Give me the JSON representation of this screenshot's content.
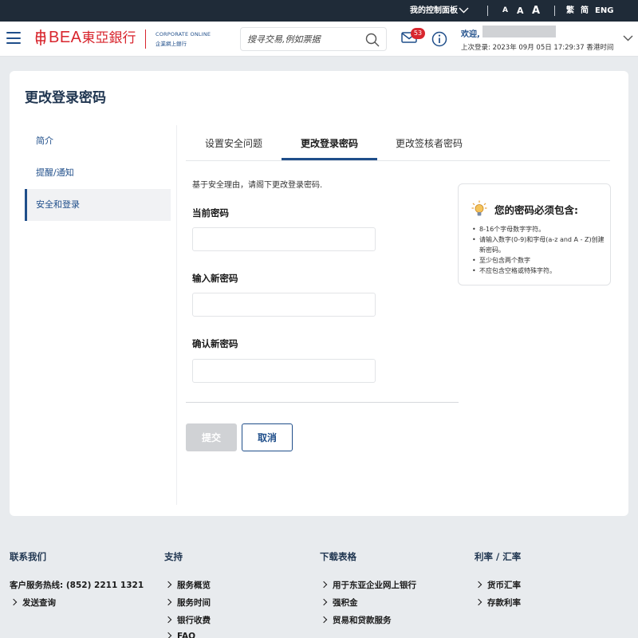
{
  "topbar": {
    "dashboard_label": "我的控制面板",
    "font_small": "A",
    "font_medium": "A",
    "font_large": "A",
    "lang_trad": "繁",
    "lang_simp": "简",
    "lang_en": "ENG"
  },
  "header": {
    "logo_text": "BEA",
    "logo_cn": "東亞銀行",
    "corporate_en": "CORPORATE ONLINE",
    "corporate_cn": "企業網上銀行",
    "search_placeholder": "搜寻交易,例如票据",
    "mail_badge": "53",
    "welcome": "欢迎,",
    "last_login": "上次登录: 2023年 09月 05日 17:29:37 香港时间"
  },
  "page": {
    "title": "更改登录密码"
  },
  "sidenav": {
    "items": [
      {
        "label": "简介"
      },
      {
        "label": "提醒/通知"
      },
      {
        "label": "安全和登录"
      }
    ]
  },
  "tabs": [
    {
      "label": "设置安全问题"
    },
    {
      "label": "更改登录密码"
    },
    {
      "label": "更改签核者密码"
    }
  ],
  "form": {
    "intro": "基于安全理由，请阁下更改登录密码.",
    "current_password_label": "当前密码",
    "new_password_label": "输入新密码",
    "confirm_password_label": "确认新密码",
    "submit_label": "提交",
    "cancel_label": "取消"
  },
  "rules": {
    "title": "您的密码必须包含:",
    "items": [
      "8-16个字母数字字符。",
      "请输入数字(0-9)和字母(a-z and A - Z)创建新密码。",
      "至少包含两个数字",
      "不应包含空格或特殊字符。"
    ]
  },
  "footer": {
    "contact": {
      "title": "联系我们",
      "hotline": "客户服务热线: (852) 2211 1321",
      "enquiry": "发送查询"
    },
    "support": {
      "title": "支持",
      "items": [
        "服务概览",
        "服务时间",
        "银行收费",
        "FAQ"
      ]
    },
    "downloads": {
      "title": "下载表格",
      "items": [
        "用于东亚企业网上银行",
        "强积金",
        "贸易和贷款服务"
      ]
    },
    "rates": {
      "title": "利率 / 汇率",
      "items": [
        "货币汇率",
        "存款利率"
      ]
    }
  },
  "colors": {
    "brand_red": "#d8262e",
    "brand_blue": "#1f4e8a",
    "topbar_bg": "#1f2b38"
  }
}
